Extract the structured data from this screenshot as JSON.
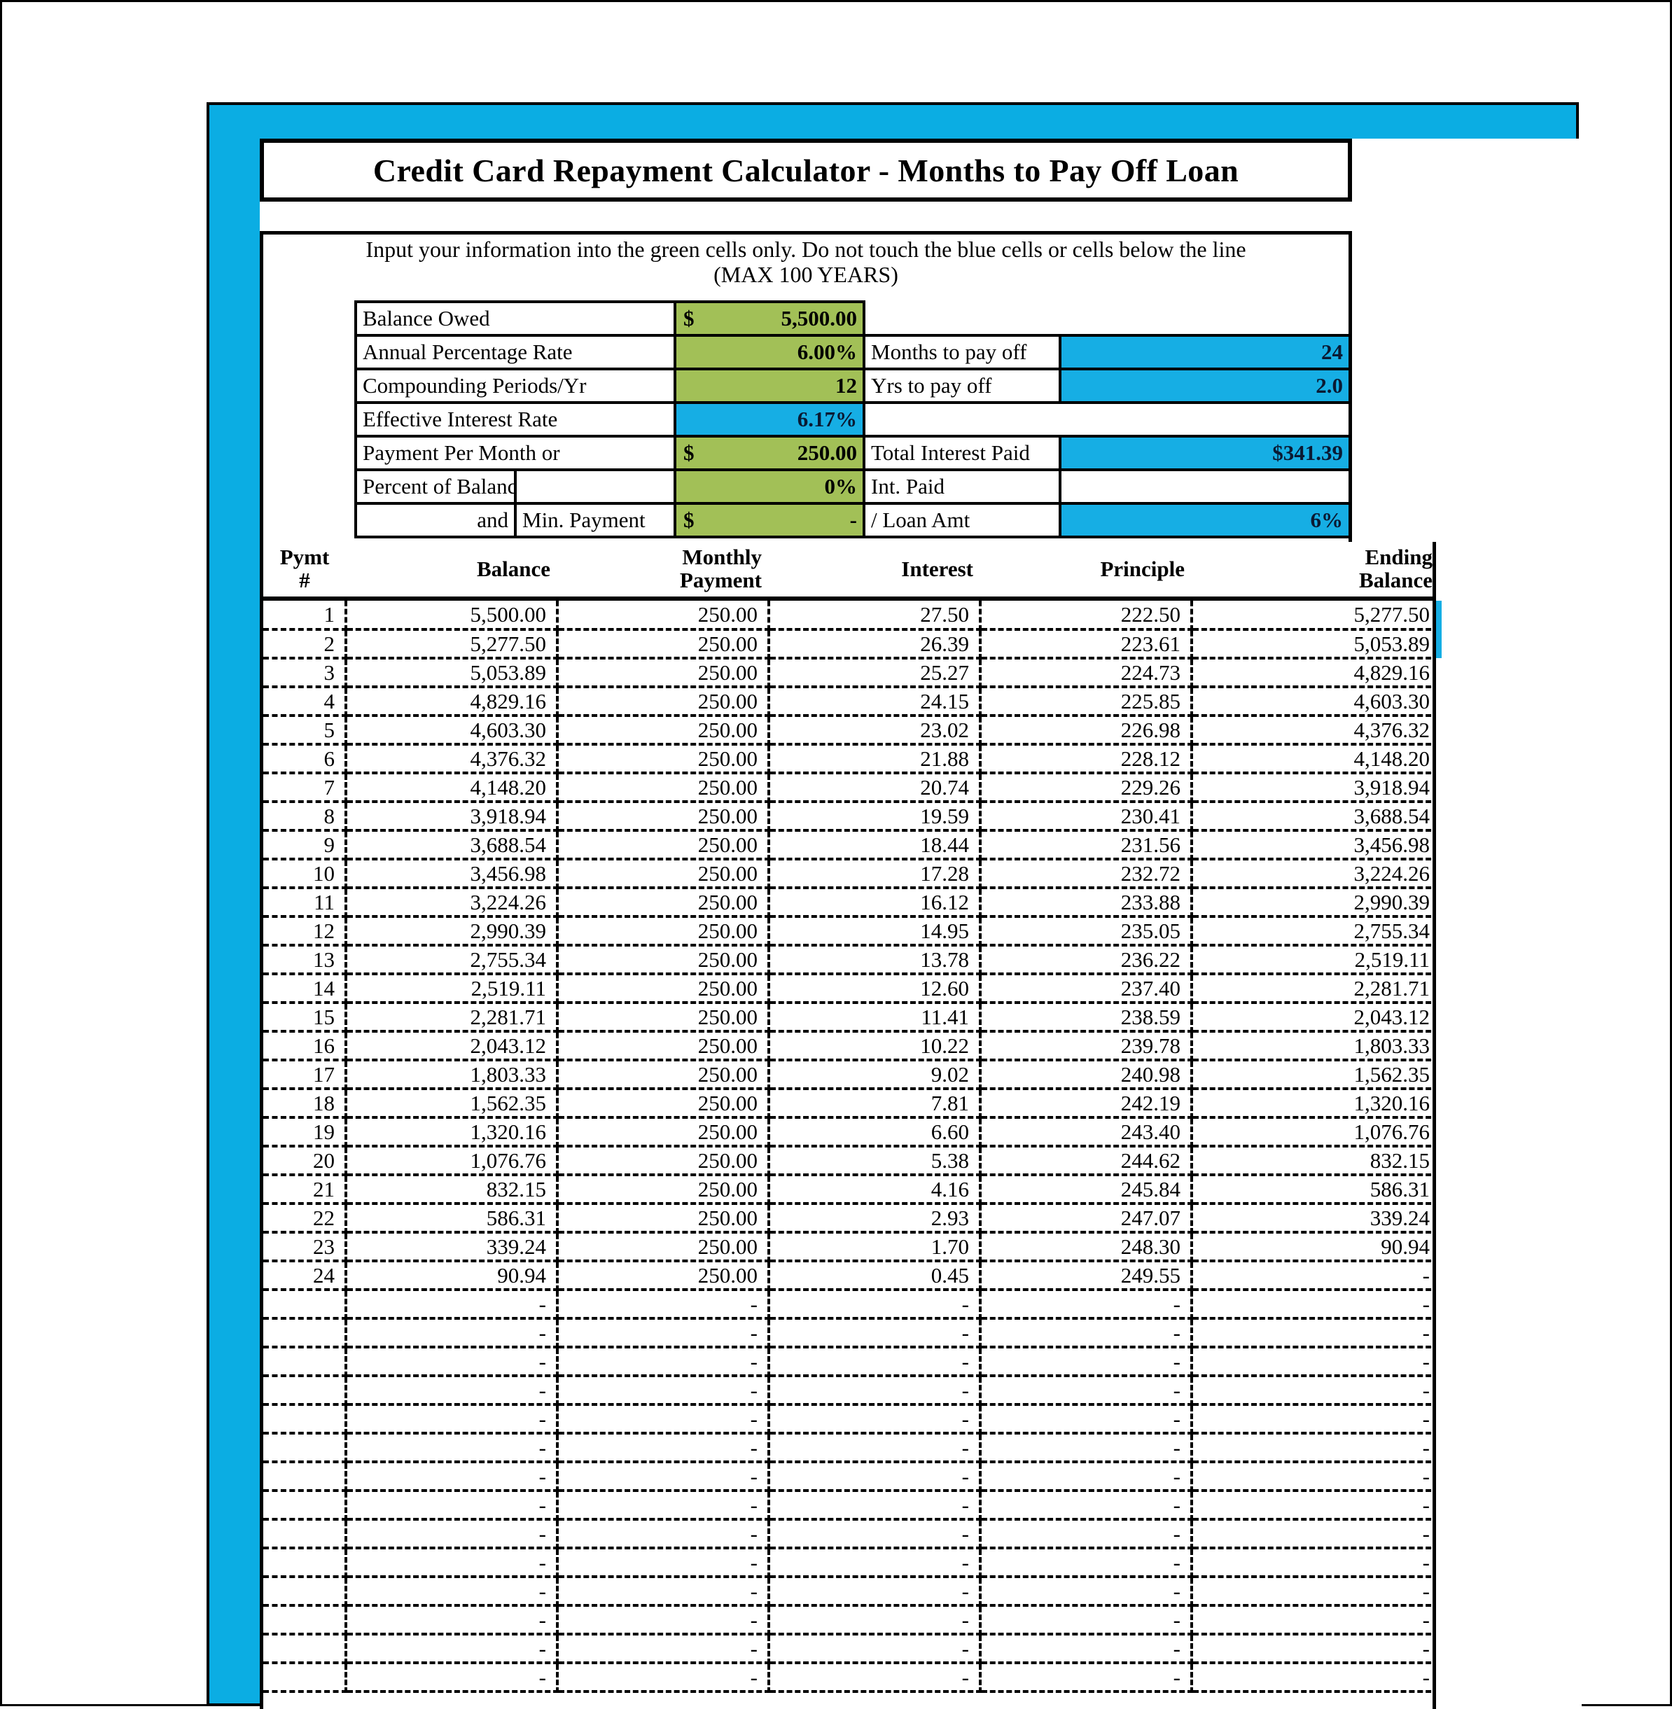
{
  "title": "Credit Card Repayment Calculator - Months to Pay Off Loan",
  "colors": {
    "frame_blue": "#0BADE3",
    "input_green": "#A2C057",
    "output_blue": "#16AEE4",
    "text_black": "#000000"
  },
  "instructions": {
    "line1": "Input your information into the green cells only.  Do not touch the blue cells or cells below the line",
    "line2": "(MAX 100 YEARS)"
  },
  "inputs": {
    "balance_owed_label": "Balance Owed",
    "balance_owed_symbol": "$",
    "balance_owed_value": "5,500.00",
    "apr_label": "Annual Percentage Rate",
    "apr_value": "6.00%",
    "compounding_label": "Compounding Periods/Yr",
    "compounding_value": "12",
    "effective_rate_label": "Effective Interest Rate",
    "effective_rate_value": "6.17%",
    "payment_per_month_label": "Payment Per Month or",
    "payment_per_month_symbol": "$",
    "payment_per_month_value": "250.00",
    "percent_of_balance_label": "Percent of Balance",
    "percent_of_balance_value": "0%",
    "and_label": "and",
    "min_payment_label": "Min. Payment",
    "min_payment_symbol": "$",
    "min_payment_value": "-"
  },
  "outputs": {
    "months_to_pay_off_label": "Months to pay off",
    "months_to_pay_off_value": "24",
    "yrs_to_pay_off_label": "Yrs to pay off",
    "yrs_to_pay_off_value": "2.0",
    "total_interest_paid_label": "Total Interest Paid",
    "total_interest_paid_value": "$341.39",
    "int_paid_label_line1": "Int. Paid",
    "int_paid_label_line2": "/ Loan Amt",
    "int_paid_ratio_value": "6%"
  },
  "table": {
    "headers": {
      "pymt_line1": "Pymt",
      "pymt_line2": "#",
      "balance_line1": "",
      "balance_line2": "Balance",
      "payment_line1": "Monthly",
      "payment_line2": "Payment",
      "interest_line1": "",
      "interest_line2": "Interest",
      "principle_line1": "",
      "principle_line2": "Principle",
      "ending_line1": "Ending",
      "ending_line2": "Balance"
    },
    "empty_marker": "-",
    "empty_row_count": 14,
    "rows": [
      {
        "n": "1",
        "balance": "5,500.00",
        "payment": "250.00",
        "interest": "27.50",
        "principle": "222.50",
        "ending": "5,277.50"
      },
      {
        "n": "2",
        "balance": "5,277.50",
        "payment": "250.00",
        "interest": "26.39",
        "principle": "223.61",
        "ending": "5,053.89"
      },
      {
        "n": "3",
        "balance": "5,053.89",
        "payment": "250.00",
        "interest": "25.27",
        "principle": "224.73",
        "ending": "4,829.16"
      },
      {
        "n": "4",
        "balance": "4,829.16",
        "payment": "250.00",
        "interest": "24.15",
        "principle": "225.85",
        "ending": "4,603.30"
      },
      {
        "n": "5",
        "balance": "4,603.30",
        "payment": "250.00",
        "interest": "23.02",
        "principle": "226.98",
        "ending": "4,376.32"
      },
      {
        "n": "6",
        "balance": "4,376.32",
        "payment": "250.00",
        "interest": "21.88",
        "principle": "228.12",
        "ending": "4,148.20"
      },
      {
        "n": "7",
        "balance": "4,148.20",
        "payment": "250.00",
        "interest": "20.74",
        "principle": "229.26",
        "ending": "3,918.94"
      },
      {
        "n": "8",
        "balance": "3,918.94",
        "payment": "250.00",
        "interest": "19.59",
        "principle": "230.41",
        "ending": "3,688.54"
      },
      {
        "n": "9",
        "balance": "3,688.54",
        "payment": "250.00",
        "interest": "18.44",
        "principle": "231.56",
        "ending": "3,456.98"
      },
      {
        "n": "10",
        "balance": "3,456.98",
        "payment": "250.00",
        "interest": "17.28",
        "principle": "232.72",
        "ending": "3,224.26"
      },
      {
        "n": "11",
        "balance": "3,224.26",
        "payment": "250.00",
        "interest": "16.12",
        "principle": "233.88",
        "ending": "2,990.39"
      },
      {
        "n": "12",
        "balance": "2,990.39",
        "payment": "250.00",
        "interest": "14.95",
        "principle": "235.05",
        "ending": "2,755.34"
      },
      {
        "n": "13",
        "balance": "2,755.34",
        "payment": "250.00",
        "interest": "13.78",
        "principle": "236.22",
        "ending": "2,519.11"
      },
      {
        "n": "14",
        "balance": "2,519.11",
        "payment": "250.00",
        "interest": "12.60",
        "principle": "237.40",
        "ending": "2,281.71"
      },
      {
        "n": "15",
        "balance": "2,281.71",
        "payment": "250.00",
        "interest": "11.41",
        "principle": "238.59",
        "ending": "2,043.12"
      },
      {
        "n": "16",
        "balance": "2,043.12",
        "payment": "250.00",
        "interest": "10.22",
        "principle": "239.78",
        "ending": "1,803.33"
      },
      {
        "n": "17",
        "balance": "1,803.33",
        "payment": "250.00",
        "interest": "9.02",
        "principle": "240.98",
        "ending": "1,562.35"
      },
      {
        "n": "18",
        "balance": "1,562.35",
        "payment": "250.00",
        "interest": "7.81",
        "principle": "242.19",
        "ending": "1,320.16"
      },
      {
        "n": "19",
        "balance": "1,320.16",
        "payment": "250.00",
        "interest": "6.60",
        "principle": "243.40",
        "ending": "1,076.76"
      },
      {
        "n": "20",
        "balance": "1,076.76",
        "payment": "250.00",
        "interest": "5.38",
        "principle": "244.62",
        "ending": "832.15"
      },
      {
        "n": "21",
        "balance": "832.15",
        "payment": "250.00",
        "interest": "4.16",
        "principle": "245.84",
        "ending": "586.31"
      },
      {
        "n": "22",
        "balance": "586.31",
        "payment": "250.00",
        "interest": "2.93",
        "principle": "247.07",
        "ending": "339.24"
      },
      {
        "n": "23",
        "balance": "339.24",
        "payment": "250.00",
        "interest": "1.70",
        "principle": "248.30",
        "ending": "90.94"
      },
      {
        "n": "24",
        "balance": "90.94",
        "payment": "250.00",
        "interest": "0.45",
        "principle": "249.55",
        "ending": "-"
      }
    ]
  }
}
